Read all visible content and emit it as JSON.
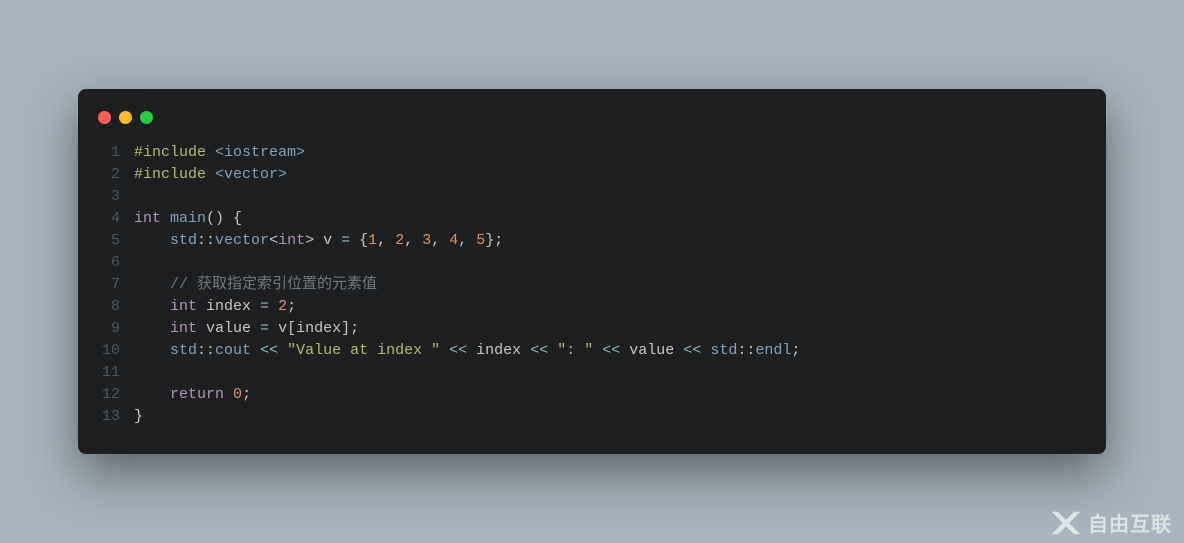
{
  "window": {
    "dots": [
      "red",
      "yellow",
      "green"
    ]
  },
  "code": {
    "lines": [
      {
        "n": "1",
        "tokens": [
          {
            "t": "#include ",
            "c": "tok-preproc"
          },
          {
            "t": "<iostream>",
            "c": "tok-include"
          }
        ]
      },
      {
        "n": "2",
        "tokens": [
          {
            "t": "#include ",
            "c": "tok-preproc"
          },
          {
            "t": "<vector>",
            "c": "tok-include"
          }
        ]
      },
      {
        "n": "3",
        "tokens": []
      },
      {
        "n": "4",
        "tokens": [
          {
            "t": "int",
            "c": "tok-type"
          },
          {
            "t": " ",
            "c": "tok-ident"
          },
          {
            "t": "main",
            "c": "tok-func"
          },
          {
            "t": "() {",
            "c": "tok-punct"
          }
        ]
      },
      {
        "n": "5",
        "tokens": [
          {
            "t": "    ",
            "c": "tok-ident"
          },
          {
            "t": "std",
            "c": "tok-ns"
          },
          {
            "t": "::",
            "c": "tok-punct"
          },
          {
            "t": "vector",
            "c": "tok-ns"
          },
          {
            "t": "<",
            "c": "tok-punct"
          },
          {
            "t": "int",
            "c": "tok-type"
          },
          {
            "t": ">",
            "c": "tok-punct"
          },
          {
            "t": " v ",
            "c": "tok-ident"
          },
          {
            "t": "=",
            "c": "tok-op"
          },
          {
            "t": " {",
            "c": "tok-punct"
          },
          {
            "t": "1",
            "c": "tok-num"
          },
          {
            "t": ", ",
            "c": "tok-punct"
          },
          {
            "t": "2",
            "c": "tok-num"
          },
          {
            "t": ", ",
            "c": "tok-punct"
          },
          {
            "t": "3",
            "c": "tok-num"
          },
          {
            "t": ", ",
            "c": "tok-punct"
          },
          {
            "t": "4",
            "c": "tok-num"
          },
          {
            "t": ", ",
            "c": "tok-punct"
          },
          {
            "t": "5",
            "c": "tok-num"
          },
          {
            "t": "};",
            "c": "tok-punct"
          }
        ]
      },
      {
        "n": "6",
        "tokens": []
      },
      {
        "n": "7",
        "tokens": [
          {
            "t": "    ",
            "c": "tok-ident"
          },
          {
            "t": "// 获取指定索引位置的元素值",
            "c": "tok-comment"
          }
        ]
      },
      {
        "n": "8",
        "tokens": [
          {
            "t": "    ",
            "c": "tok-ident"
          },
          {
            "t": "int",
            "c": "tok-type"
          },
          {
            "t": " index ",
            "c": "tok-ident"
          },
          {
            "t": "=",
            "c": "tok-op"
          },
          {
            "t": " ",
            "c": "tok-ident"
          },
          {
            "t": "2",
            "c": "tok-num"
          },
          {
            "t": ";",
            "c": "tok-punct"
          }
        ]
      },
      {
        "n": "9",
        "tokens": [
          {
            "t": "    ",
            "c": "tok-ident"
          },
          {
            "t": "int",
            "c": "tok-type"
          },
          {
            "t": " value ",
            "c": "tok-ident"
          },
          {
            "t": "=",
            "c": "tok-op"
          },
          {
            "t": " v[index];",
            "c": "tok-ident"
          }
        ]
      },
      {
        "n": "10",
        "tokens": [
          {
            "t": "    ",
            "c": "tok-ident"
          },
          {
            "t": "std",
            "c": "tok-ns"
          },
          {
            "t": "::",
            "c": "tok-punct"
          },
          {
            "t": "cout",
            "c": "tok-ns"
          },
          {
            "t": " ",
            "c": "tok-ident"
          },
          {
            "t": "<<",
            "c": "tok-op"
          },
          {
            "t": " ",
            "c": "tok-ident"
          },
          {
            "t": "\"Value at index \"",
            "c": "tok-str"
          },
          {
            "t": " ",
            "c": "tok-ident"
          },
          {
            "t": "<<",
            "c": "tok-op"
          },
          {
            "t": " index ",
            "c": "tok-ident"
          },
          {
            "t": "<<",
            "c": "tok-op"
          },
          {
            "t": " ",
            "c": "tok-ident"
          },
          {
            "t": "\": \"",
            "c": "tok-str"
          },
          {
            "t": " ",
            "c": "tok-ident"
          },
          {
            "t": "<<",
            "c": "tok-op"
          },
          {
            "t": " value ",
            "c": "tok-ident"
          },
          {
            "t": "<<",
            "c": "tok-op"
          },
          {
            "t": " ",
            "c": "tok-ident"
          },
          {
            "t": "std",
            "c": "tok-ns"
          },
          {
            "t": "::",
            "c": "tok-punct"
          },
          {
            "t": "endl",
            "c": "tok-ns"
          },
          {
            "t": ";",
            "c": "tok-punct"
          }
        ]
      },
      {
        "n": "11",
        "tokens": []
      },
      {
        "n": "12",
        "tokens": [
          {
            "t": "    ",
            "c": "tok-ident"
          },
          {
            "t": "return",
            "c": "tok-keyword"
          },
          {
            "t": " ",
            "c": "tok-ident"
          },
          {
            "t": "0",
            "c": "tok-num"
          },
          {
            "t": ";",
            "c": "tok-punct"
          }
        ]
      },
      {
        "n": "13",
        "tokens": [
          {
            "t": "}",
            "c": "tok-punct"
          }
        ]
      }
    ]
  },
  "watermark": {
    "text": "自由互联"
  }
}
